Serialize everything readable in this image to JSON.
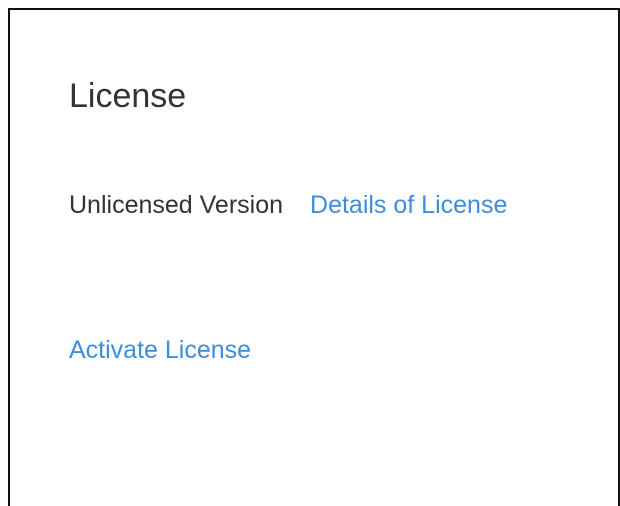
{
  "license": {
    "title": "License",
    "status": "Unlicensed Version",
    "details_link": "Details of License",
    "activate_link": "Activate License"
  },
  "colors": {
    "text": "#333333",
    "link": "#3c8dde",
    "border": "#111111",
    "background": "#ffffff"
  }
}
